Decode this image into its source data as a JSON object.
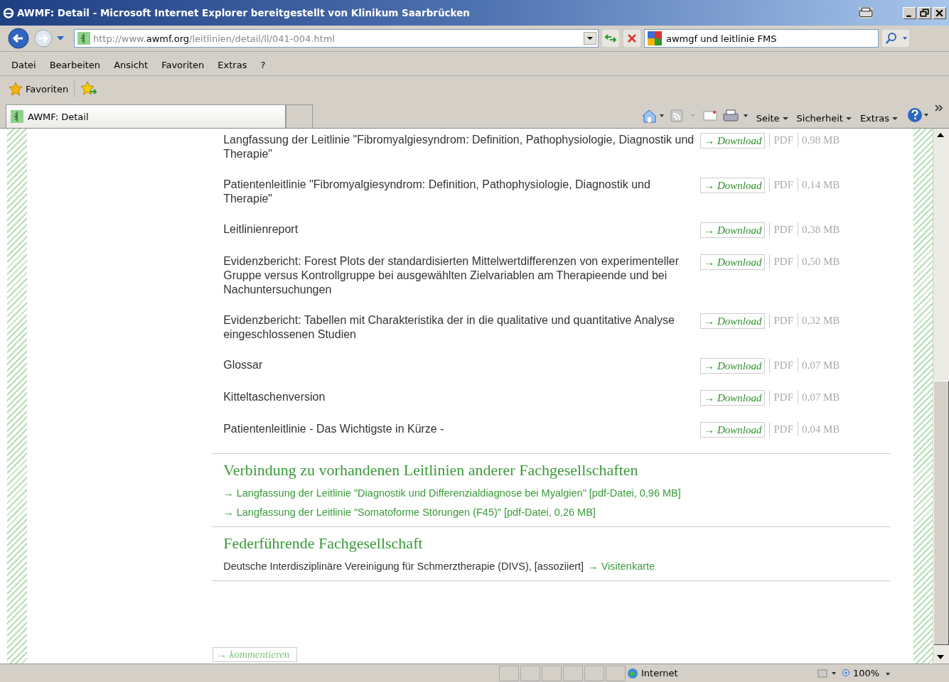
{
  "window": {
    "title": "AWMF: Detail - Microsoft Internet Explorer bereitgestellt von Klinikum Saarbrücken"
  },
  "address_bar": {
    "url_parts": [
      {
        "text": "http://www.",
        "emphasis": false
      },
      {
        "text": "awmf.org",
        "emphasis": true
      },
      {
        "text": "/leitlinien/detail/ll/041-004.html",
        "emphasis": false
      }
    ]
  },
  "search": {
    "value": "awmgf und leitlinie FMS"
  },
  "menu": [
    "Datei",
    "Bearbeiten",
    "Ansicht",
    "Favoriten",
    "Extras",
    "?"
  ],
  "favorites_bar": {
    "label": "Favoriten"
  },
  "tabs": [
    {
      "label": "AWMF: Detail",
      "selected": true
    }
  ],
  "command_bar": [
    "Seite",
    "Sicherheit",
    "Extras"
  ],
  "documents": [
    {
      "title": "Langfassung der Leitlinie \"Fibromyalgiesyndrom: Definition, Pathophysiologie, Diagnostik und Therapie\"",
      "button": "→ Download",
      "type": "PDF",
      "size": "0,98 MB"
    },
    {
      "title": "Patientenleitlinie \"Fibromyalgiesyndrom: Definition, Pathophysiologie, Diagnostik und Therapie\"",
      "button": "→ Download",
      "type": "PDF",
      "size": "0,14 MB"
    },
    {
      "title": "Leitlinienreport",
      "button": "→ Download",
      "type": "PDF",
      "size": "0,38 MB"
    },
    {
      "title": "Evidenzbericht: Forest Plots der standardisierten Mittelwertdifferenzen von experimenteller Gruppe versus Kontrollgruppe bei ausgewählten Zielvariablen am Therapieende und bei Nachuntersuchungen",
      "button": "→ Download",
      "type": "PDF",
      "size": "0,50 MB"
    },
    {
      "title": "Evidenzbericht: Tabellen mit Charakteristika der in die qualitative und quantitative Analyse eingeschlossenen Studien",
      "button": "→ Download",
      "type": "PDF",
      "size": "0,32 MB"
    },
    {
      "title": "Glossar",
      "button": "→ Download",
      "type": "PDF",
      "size": "0,07 MB"
    },
    {
      "title": "Kitteltaschenversion",
      "button": "→ Download",
      "type": "PDF",
      "size": "0,07 MB"
    },
    {
      "title": "Patientenleitlinie - Das Wichtigste in Kürze -",
      "button": "→ Download",
      "type": "PDF",
      "size": "0,04 MB"
    }
  ],
  "related": {
    "heading": "Verbindung zu vorhandenen Leitlinien anderer Fachgesellschaften",
    "links": [
      "→ Langfassung der Leitlinie \"Diagnostik und Differenzialdiagnose bei Myalgien\" [pdf-Datei, 0,96 MB]",
      "→ Langfassung der Leitlinie \"Somatoforme Störungen (F45)\" [pdf-Datei, 0,26 MB]"
    ]
  },
  "lead_society": {
    "heading": "Federführende Fachgesellschaft",
    "text": "Deutsche Interdisziplinäre Vereinigung für Schmerztherapie (DIVS), [assoziiert]",
    "link": "→ Visitenkarte"
  },
  "comment_button": "→ kommentieren",
  "status_bar": {
    "zone": "Internet",
    "zoom": "100%"
  }
}
